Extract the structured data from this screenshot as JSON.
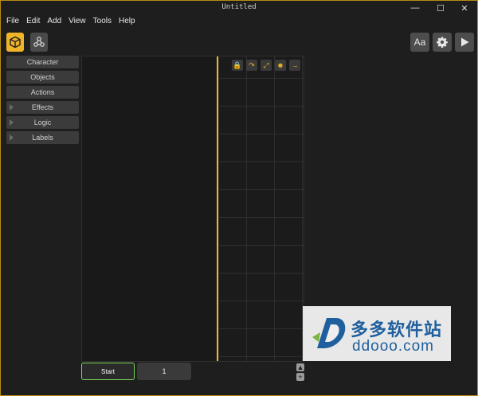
{
  "window": {
    "title": "Untitled",
    "controls": [
      "—",
      "☐",
      "✕"
    ]
  },
  "menu": {
    "items": [
      "File",
      "Edit",
      "Add",
      "View",
      "Tools",
      "Help"
    ]
  },
  "toolbar": {
    "left_tools": [
      {
        "icon": "cube-icon",
        "active": true
      },
      {
        "icon": "molecule-icon",
        "active": false
      }
    ],
    "font_button_label": "Aa",
    "settings_icon": "gear-icon",
    "play_icon": "play-icon"
  },
  "sidebar": {
    "items": [
      {
        "label": "Character",
        "expandable": false
      },
      {
        "label": "Objects",
        "expandable": false
      },
      {
        "label": "Actions",
        "expandable": false
      },
      {
        "label": "Effects",
        "expandable": true
      },
      {
        "label": "Logic",
        "expandable": true
      },
      {
        "label": "Labels",
        "expandable": true
      }
    ]
  },
  "grid_tools": [
    {
      "icon": "lock-icon",
      "glyph": "🔒"
    },
    {
      "icon": "rotate-icon",
      "glyph": "↷"
    },
    {
      "icon": "resize-icon",
      "glyph": "⤢"
    },
    {
      "icon": "character-icon",
      "glyph": "☻"
    },
    {
      "icon": "arrow-right-icon",
      "glyph": "→"
    }
  ],
  "bottom": {
    "start_label": "Start",
    "page_label": "1",
    "up_glyph": "▲",
    "add_glyph": "+"
  },
  "watermark": {
    "chinese_text": "多多软件站",
    "url": "ddooo.com"
  },
  "colors": {
    "accent": "#f0b429",
    "start_border": "#7ed957",
    "watermark_blue": "#1f5f9e"
  }
}
